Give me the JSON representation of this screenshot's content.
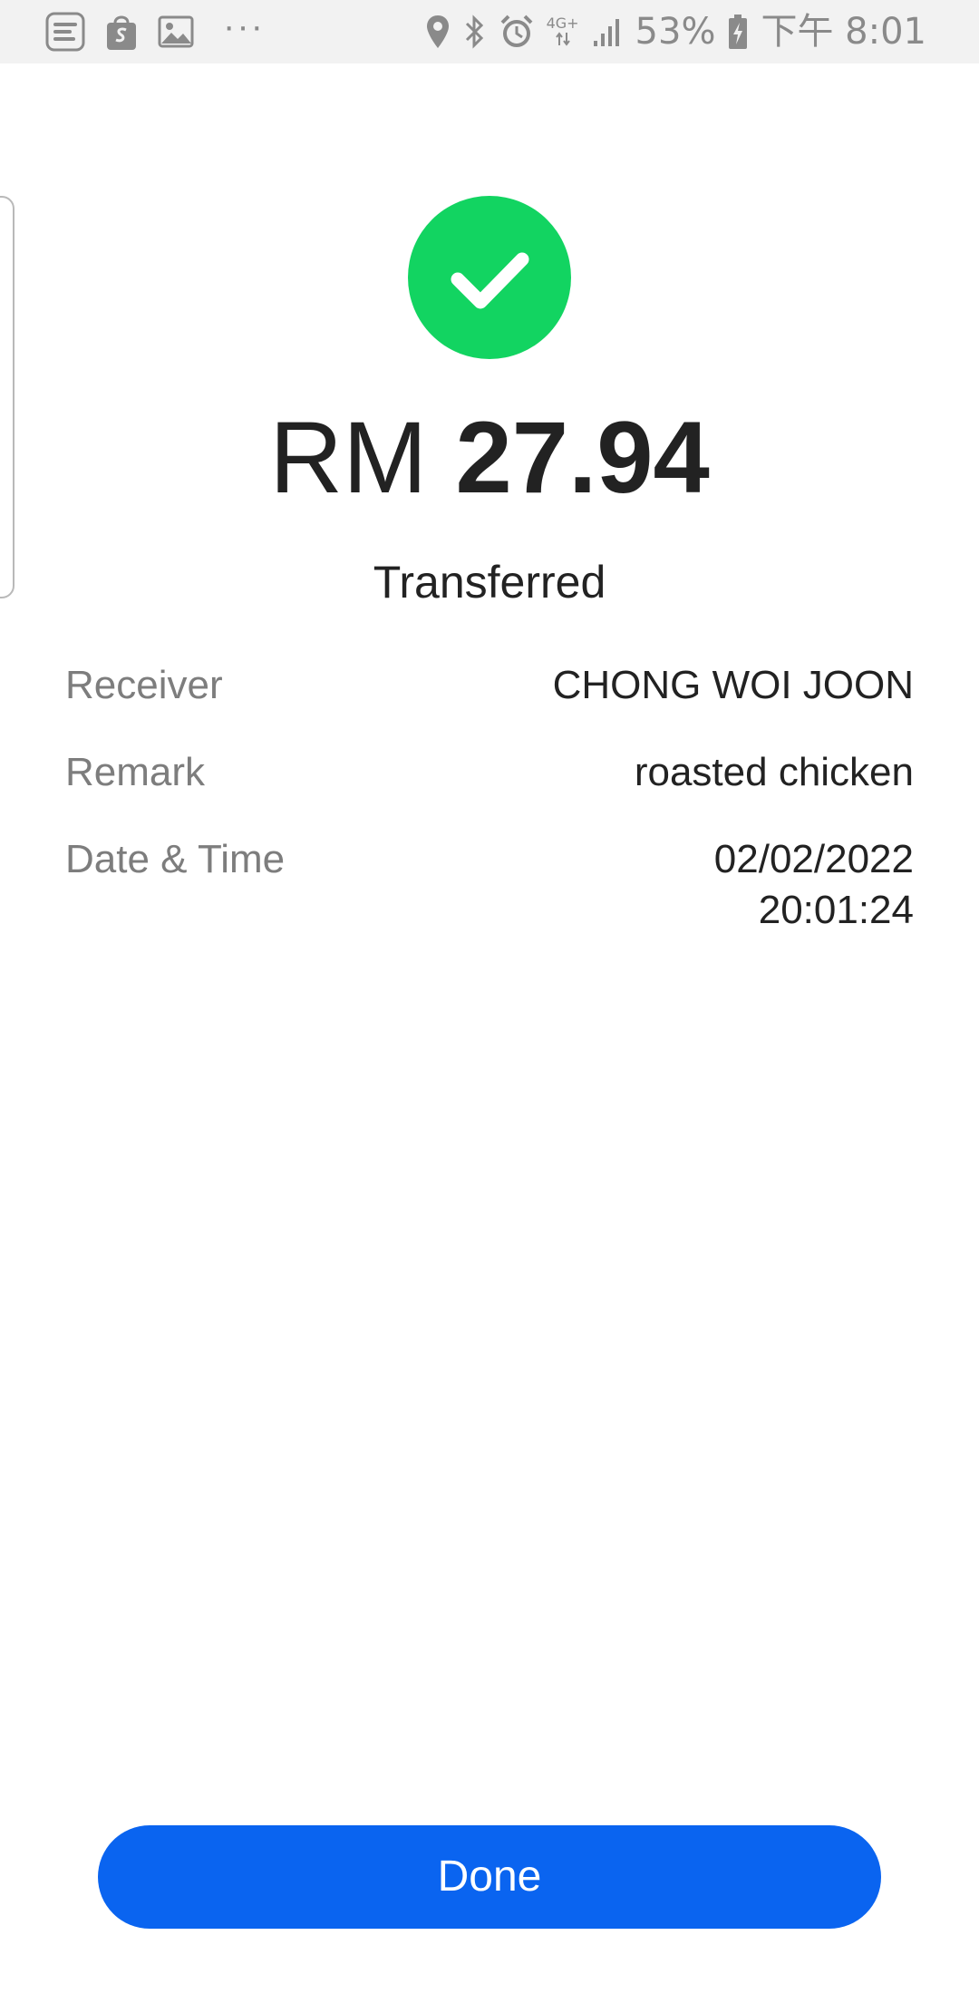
{
  "status_bar": {
    "notification_icons": [
      "touch-n-go-ewallet-icon",
      "shopping-bag-icon",
      "gallery-icon"
    ],
    "more_dots": "···",
    "network": "4G+",
    "battery_percent": "53%",
    "time": "下午 8:01"
  },
  "colors": {
    "success_green": "#12D461",
    "primary_blue": "#0A64F0",
    "label_gray": "#7D7D7D",
    "text_dark": "#222222"
  },
  "transfer": {
    "currency": "RM",
    "amount": "27.94",
    "status": "Transferred"
  },
  "details": {
    "receiver": {
      "label": "Receiver",
      "value": "CHONG WOI JOON"
    },
    "remark": {
      "label": "Remark",
      "value": "roasted chicken"
    },
    "datetime": {
      "label": "Date & Time",
      "date": "02/02/2022",
      "time": "20:01:24"
    }
  },
  "actions": {
    "done_label": "Done"
  }
}
